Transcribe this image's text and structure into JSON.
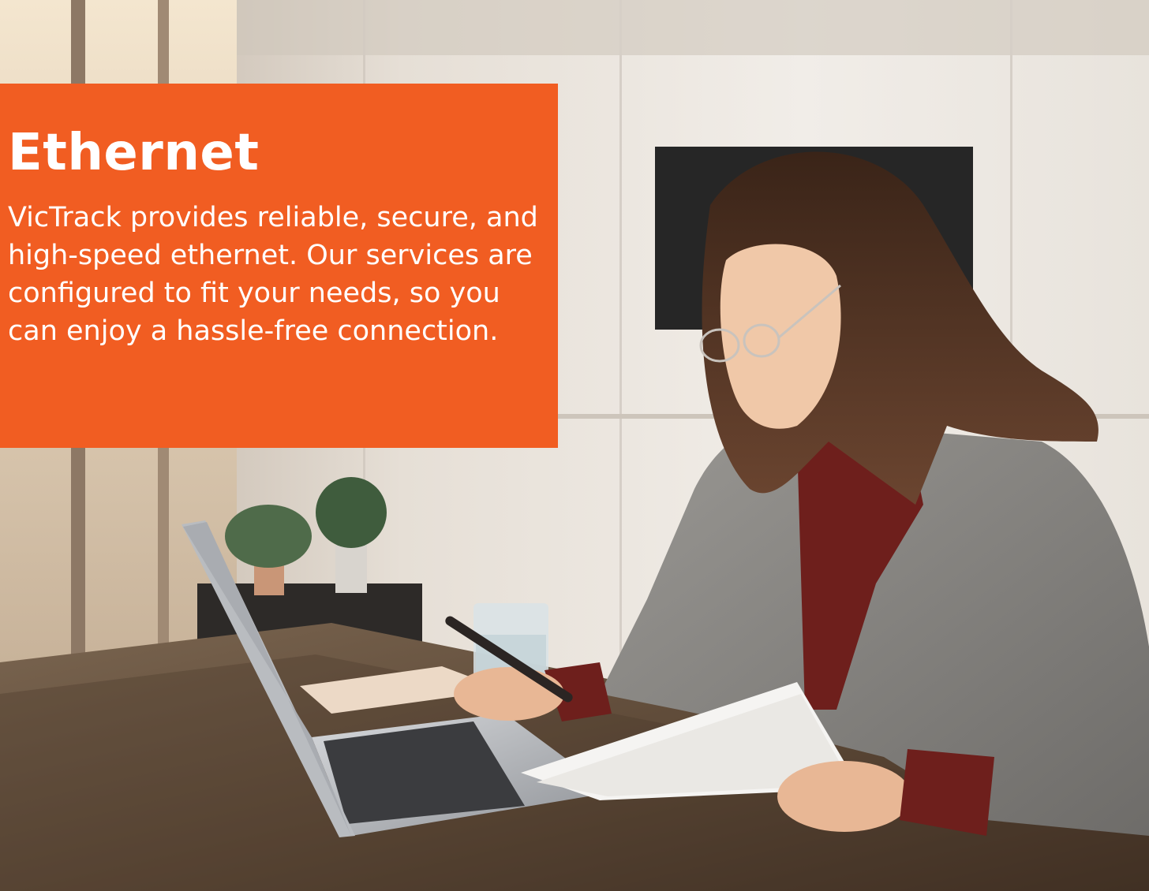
{
  "hero": {
    "title": "Ethernet",
    "description": "VicTrack provides reliable, secure, and high-speed ethernet. Our services are configured to fit your needs, so you can enjoy a hassle-free connection."
  },
  "colors": {
    "brand_orange": "#f15d22",
    "text_on_brand": "#ffffff"
  }
}
